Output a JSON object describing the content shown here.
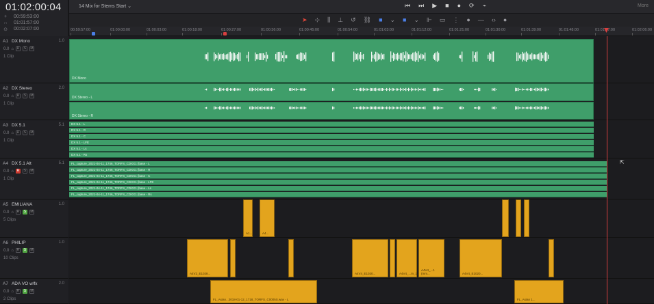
{
  "timecode": {
    "main": "01:02:00:04",
    "rows": [
      {
        "icon": "+",
        "value": "00:59:53:00"
      },
      {
        "icon": "↔",
        "value": "01:01:57:00"
      },
      {
        "icon": "⊙",
        "value": "00:02:07:00"
      }
    ]
  },
  "timeline_title": "14 Mix for Stems Start ⌄",
  "transport": [
    "⏮",
    "⏭",
    "▶",
    "■",
    "●",
    "⟳",
    "⌁"
  ],
  "top_right": "More",
  "tools": [
    "➤",
    "⊹",
    "⫼",
    "⊥",
    "↺",
    "⛓",
    "■",
    "⌄",
    "■",
    "⌄",
    "⊩",
    "▭",
    "⋮",
    "●",
    "—",
    "‹›",
    "●"
  ],
  "ruler": {
    "labels": [
      "00:59:57:00",
      "01:00:00:00",
      "01:00:03:00",
      "01:00:18:00",
      "01:00:27:00",
      "01:00:36:00",
      "01:00:45:00",
      "01:00:54:00",
      "01:01:03:00",
      "01:01:12:00",
      "01:01:21:00",
      "01:01:30:00",
      "01:01:39:00",
      "01:01:48:00",
      "01:01:57:00",
      "01:02:06:00"
    ]
  },
  "tracks": [
    {
      "id": "A1",
      "name": "DX Mono",
      "chan": "1.0",
      "vol": "0.0",
      "clips": "1 Clip"
    },
    {
      "id": "A2",
      "name": "DX Stereo",
      "chan": "2.0",
      "vol": "0.0",
      "clips": "1 Clip"
    },
    {
      "id": "A3",
      "name": "DX 5.1",
      "chan": "5.1",
      "vol": "0.0",
      "clips": "1 Clip"
    },
    {
      "id": "A4",
      "name": "DX 5.1 Alt",
      "chan": "5.1",
      "vol": "0.0",
      "clips": "1 Clip"
    },
    {
      "id": "A5",
      "name": "EMILIANA",
      "chan": "1.0",
      "vol": "0.0",
      "clips": "5 Clips"
    },
    {
      "id": "A6",
      "name": "PHILIP",
      "chan": "1.0",
      "vol": "0.0",
      "clips": "10 Clips"
    },
    {
      "id": "A7",
      "name": "ADA VO w/fx",
      "chan": "2.0",
      "vol": "0.0",
      "clips": "2 Clips"
    }
  ],
  "track_buttons": {
    "lock": "⌂",
    "r": "R",
    "s": "S",
    "m": "M",
    "fx": "fx"
  },
  "green_labels": {
    "a1": "DX Mono",
    "a2_l": "DX Stereo - L",
    "a2_r": "DX Stereo - R",
    "a3": [
      "DX 5.1 - L",
      "DX 5.1 - R",
      "DX 5.1 - C",
      "DX 5.1 - LFE",
      "DX 5.1 - Ls",
      "DX 5.1 - Rs"
    ],
    "a4": [
      "FL_capture_2021-04-11_1746_TORFS_CDXX1 (base - L",
      "FL_capture_2021-04-11_1746_TORFS_CDXX1 (base - R",
      "FL_capture_2021-04-11_1746_TORFS_CDXX1 (base - C",
      "FL_capture_2021-04-11_1746_TORFS_CDXX1 (base - LFE",
      "FL_capture_2021-04-11_1746_TORFS_CDXX1 (base - Ls",
      "FL_capture_2021-04-11_1746_TORFS_CDXX1 (base - Rs"
    ]
  },
  "yellow_labels": {
    "a5": [
      "A1...",
      "A4..."
    ],
    "a6": [
      "A4V2_E1028...",
      "A4V4_E1020...",
      "A4V4_...m_1...",
      "A4V4_...1 (mm...",
      "A4V4_E1020..."
    ],
    "a7": [
      "FL_Asian...2018-01-12_1718_TORFS_C0005S.wav - L",
      "FL_Asian 1..."
    ]
  },
  "colors": {
    "green": "#3f9e6a",
    "yellow": "#e3a41d",
    "playhead": "#d84040",
    "accent_blue": "#4b7fe6"
  },
  "cursor_icon": "pointer-cursor-icon"
}
